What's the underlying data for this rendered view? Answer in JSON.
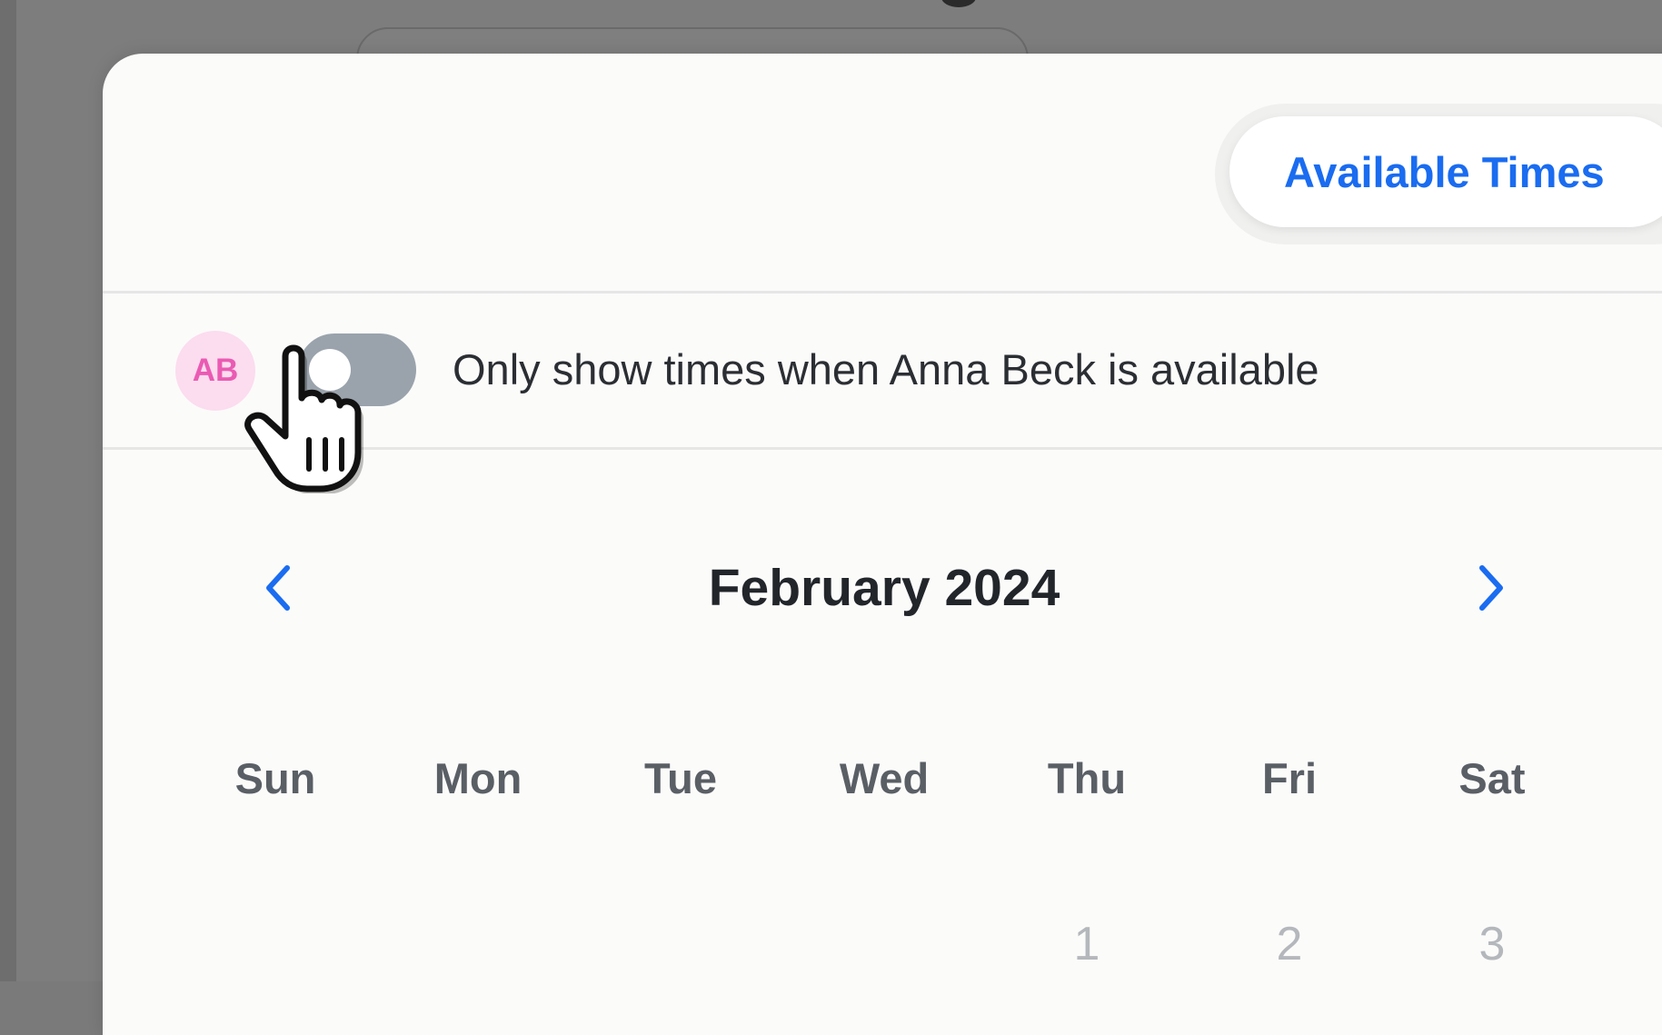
{
  "header": {
    "segment_label": "Available Times"
  },
  "filter": {
    "avatar_initials": "AB",
    "toggle_on": false,
    "toggle_label": "Only show times when Anna Beck is available"
  },
  "calendar": {
    "month_label": "February 2024",
    "prev_icon": "chevron-left-icon",
    "next_icon": "chevron-right-icon",
    "weekdays": [
      "Sun",
      "Mon",
      "Tue",
      "Wed",
      "Thu",
      "Fri",
      "Sat"
    ],
    "first_week_days": [
      "",
      "",
      "",
      "",
      "1",
      "2",
      "3"
    ]
  },
  "colors": {
    "accent": "#1a6cf0",
    "avatar_bg": "#fcdcef",
    "avatar_text": "#ea5bb3",
    "toggle_off": "#9aa3ac",
    "day_muted": "#b4b7bb"
  }
}
